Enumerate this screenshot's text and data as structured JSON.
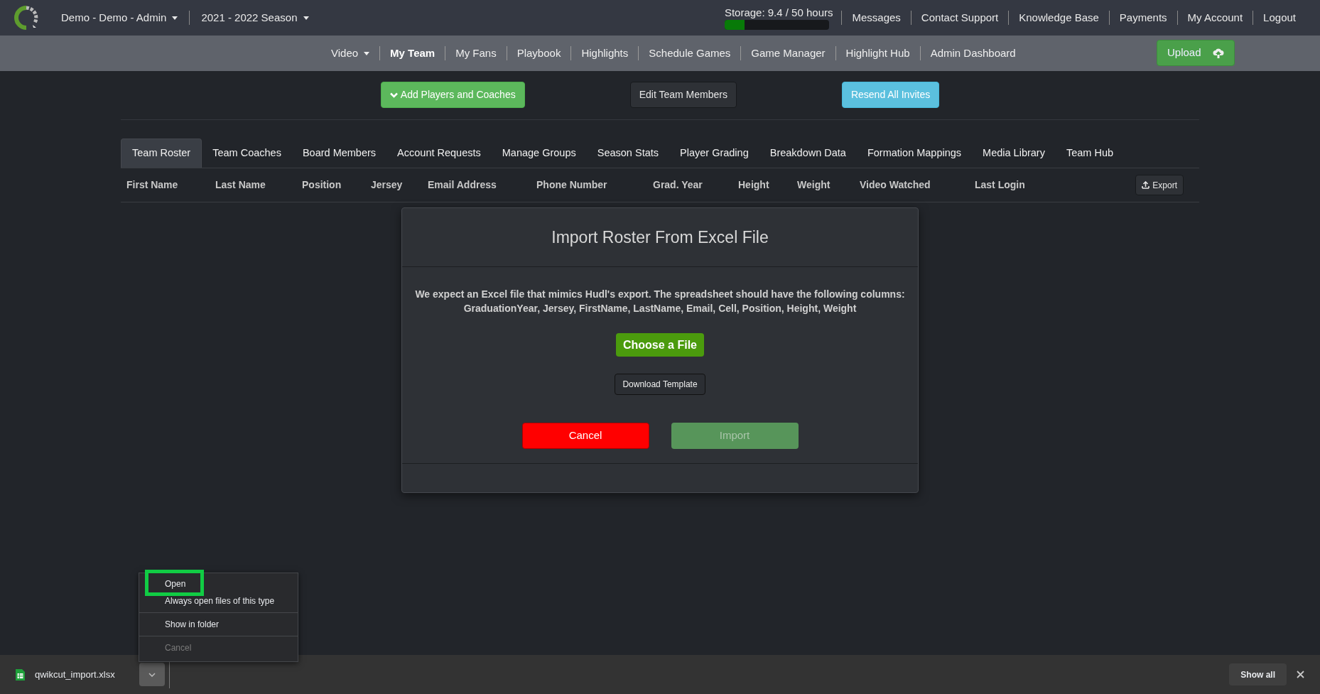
{
  "top_bar": {
    "team_menu": "Demo - Demo - Admin",
    "season_menu": "2021 - 2022 Season",
    "storage": {
      "label": "Storage: 9.4 / 50 hours",
      "level": 0.19
    },
    "links": [
      "Messages",
      "Contact Support",
      "Knowledge Base",
      "Payments",
      "My Account",
      "Logout"
    ]
  },
  "nav": {
    "items": [
      {
        "label": "Video",
        "dropdown": true,
        "selected": false
      },
      {
        "label": "My Team",
        "dropdown": false,
        "selected": true
      },
      {
        "label": "My Fans",
        "dropdown": false,
        "selected": false
      },
      {
        "label": "Playbook",
        "dropdown": false,
        "selected": false
      },
      {
        "label": "Highlights",
        "dropdown": false,
        "selected": false
      },
      {
        "label": "Schedule Games",
        "dropdown": false,
        "selected": false
      },
      {
        "label": "Game Manager",
        "dropdown": false,
        "selected": false
      },
      {
        "label": "Highlight Hub",
        "dropdown": false,
        "selected": false
      },
      {
        "label": "Admin Dashboard",
        "dropdown": false,
        "selected": false
      }
    ],
    "upload_button": "Upload"
  },
  "actions": [
    {
      "label": "Add Players and Coaches",
      "kind": "success"
    },
    {
      "label": "Edit Team Members",
      "kind": "default"
    },
    {
      "label": "Resend All Invites",
      "kind": "info"
    }
  ],
  "tabs": [
    {
      "label": "Team Roster",
      "selected": true
    },
    {
      "label": "Team Coaches",
      "selected": false
    },
    {
      "label": "Board Members",
      "selected": false
    },
    {
      "label": "Account Requests",
      "selected": false
    },
    {
      "label": "Manage Groups",
      "selected": false
    },
    {
      "label": "Season Stats",
      "selected": false
    },
    {
      "label": "Player Grading",
      "selected": false
    },
    {
      "label": "Breakdown Data",
      "selected": false
    },
    {
      "label": "Formation Mappings",
      "selected": false
    },
    {
      "label": "Media Library",
      "selected": false
    },
    {
      "label": "Team Hub",
      "selected": false
    }
  ],
  "table": {
    "columns": [
      "First Name",
      "Last Name",
      "Position",
      "Jersey",
      "Email Address",
      "Phone Number",
      "Grad. Year",
      "Height",
      "Weight",
      "Video Watched",
      "Last Login"
    ],
    "export_button": "Export"
  },
  "modal": {
    "title": "Import Roster From Excel File",
    "message": "We expect an Excel file that mimics Hudl's export. The spreadsheet should have the following columns: GraduationYear, Jersey, FirstName, LastName, Email, Cell, Position, Height, Weight",
    "choose_button": "Choose a File",
    "template_button": "Download Template",
    "cancel_button": "Cancel",
    "import_button": {
      "label": "Import",
      "disabled": true
    }
  },
  "download_bar": {
    "file": "qwikcut_import.xlsx",
    "menu": [
      [
        {
          "label": "Open",
          "highlighted": true,
          "disabled": false
        },
        {
          "label": "Always open files of this type",
          "highlighted": false,
          "disabled": false
        }
      ],
      [
        {
          "label": "Show in folder",
          "highlighted": false,
          "disabled": false
        }
      ],
      [
        {
          "label": "Cancel",
          "highlighted": false,
          "disabled": true
        }
      ]
    ],
    "show_all": "Show all"
  }
}
